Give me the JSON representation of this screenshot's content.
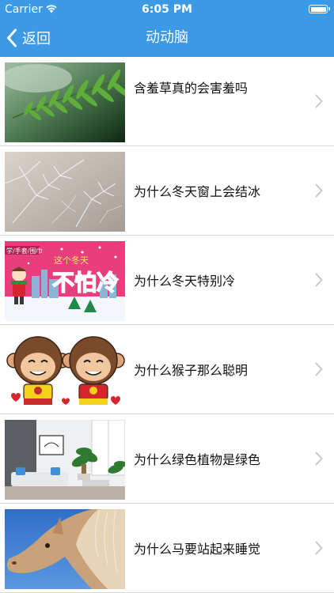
{
  "status_bar": {
    "carrier": "Carrier",
    "time": "6:05 PM"
  },
  "nav": {
    "back_label": "返回",
    "title": "动动脑"
  },
  "items": [
    {
      "title": "含羞草真的会害羞吗",
      "image": "mimosa-leaf"
    },
    {
      "title": "为什么冬天窗上会结冰",
      "image": "frost-pattern"
    },
    {
      "title": "为什么冬天特别冷",
      "image": "winter-cartoon"
    },
    {
      "title": "为什么猴子那么聪明",
      "image": "cartoon-monkeys"
    },
    {
      "title": "为什么绿色植物是绿色",
      "image": "living-room-plants"
    },
    {
      "title": "为什么马要站起来睡觉",
      "image": "horse-head"
    }
  ],
  "thumb_texts": {
    "winter_banner_left": "学/手套/围巾",
    "winter_banner_small": "这个冬天",
    "winter_banner_big": "不怕冷"
  },
  "colors": {
    "nav_blue": "#3b99e6",
    "separator": "#d8d8d8",
    "chevron": "#c7c7cc"
  }
}
